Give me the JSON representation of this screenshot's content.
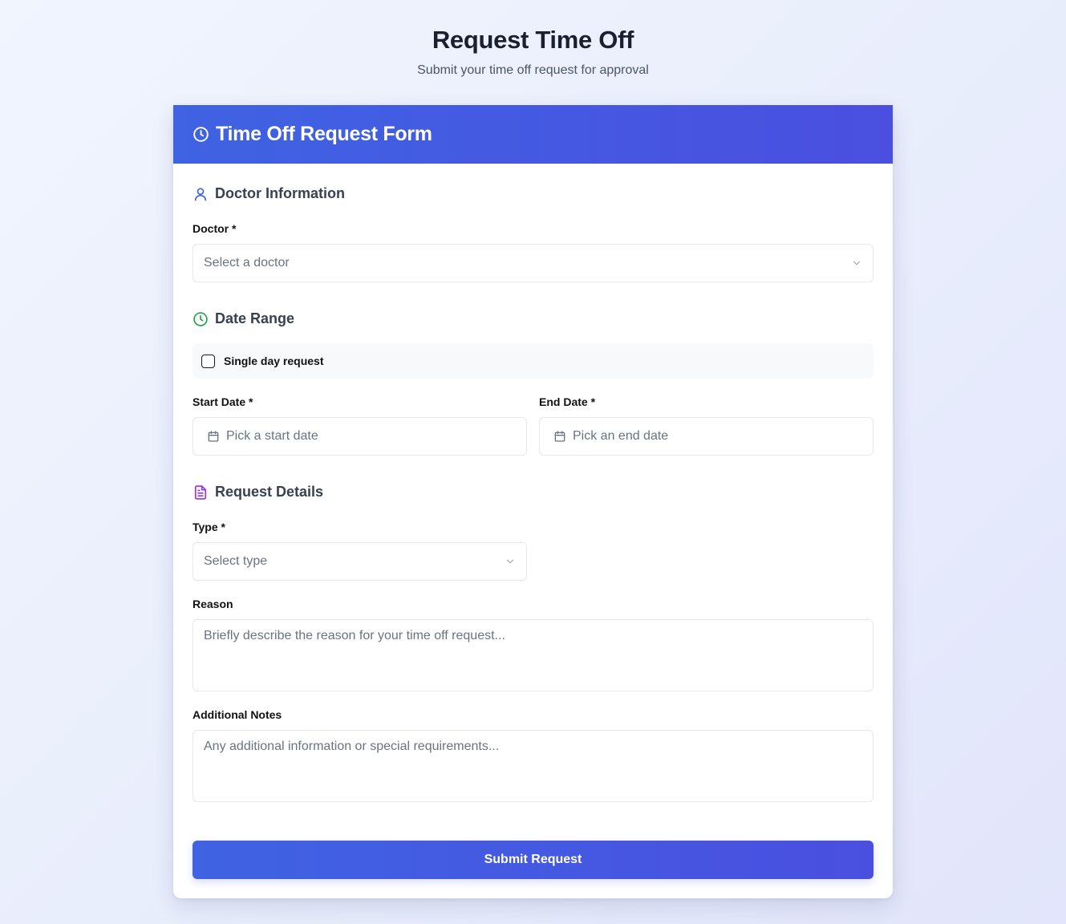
{
  "page": {
    "title": "Request Time Off",
    "subtitle": "Submit your time off request for approval"
  },
  "form": {
    "title": "Time Off Request Form",
    "header_icon": "clock-icon",
    "sections": {
      "doctor": {
        "title": "Doctor Information",
        "icon": "user-icon",
        "icon_color": "#3f63e2",
        "doctor_label": "Doctor *",
        "doctor_placeholder": "Select a doctor"
      },
      "date_range": {
        "title": "Date Range",
        "icon": "clock-icon",
        "icon_color": "#22a34a",
        "single_day_label": "Single day request",
        "single_day_checked": false,
        "start_label": "Start Date *",
        "start_placeholder": "Pick a start date",
        "end_label": "End Date *",
        "end_placeholder": "Pick an end date"
      },
      "details": {
        "title": "Request Details",
        "icon": "document-icon",
        "icon_color": "#9333ea",
        "type_label": "Type *",
        "type_placeholder": "Select type",
        "reason_label": "Reason",
        "reason_placeholder": "Briefly describe the reason for your time off request...",
        "notes_label": "Additional Notes",
        "notes_placeholder": "Any additional information or special requirements..."
      }
    },
    "submit_label": "Submit Request"
  },
  "colors": {
    "accent_start": "#3f63e2",
    "accent_end": "#4a4fe0"
  }
}
